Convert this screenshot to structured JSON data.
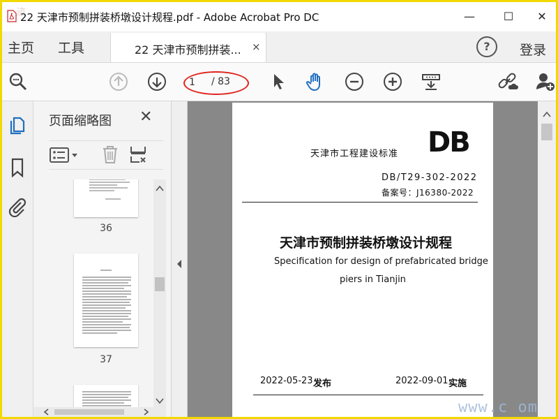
{
  "window": {
    "title": "22 天津市预制拼装桥墩设计规程.pdf - Adobe Acrobat Pro DC",
    "minimize": "—",
    "maximize": "☐",
    "close": "✕"
  },
  "menu": {
    "home": "主页",
    "tools": "工具",
    "help": "?",
    "login": "登录"
  },
  "tab": {
    "label": "22 天津市预制拼装...",
    "close": "×"
  },
  "toolbar": {
    "page_current": "1",
    "page_total": "/ 83",
    "icons": [
      "search-zoom-icon",
      "page-up-icon",
      "page-down-icon",
      "select-cursor-icon",
      "hand-tool-icon",
      "zoom-out-icon",
      "zoom-in-icon",
      "page-fit-icon",
      "share-link-icon",
      "add-user-icon"
    ],
    "accent": "#1f6fc1",
    "highlight": "#e0231d"
  },
  "sidebar": {
    "panel_title": "页面缩略图",
    "panel_close": "✕",
    "thumbnails": [
      {
        "label": "36"
      },
      {
        "label": "37"
      }
    ]
  },
  "document": {
    "issuer": "天津市工程建设标准",
    "logo": "DB",
    "code": "DB/T29-302-2022",
    "record": "备案号：J16380-2022",
    "title_cn": "天津市预制拼装桥墩设计规程",
    "title_en_1": "Specification for design of prefabricated bridge",
    "title_en_2": "piers in Tianjin",
    "publish_date": "2022-05-23",
    "publish_label": "发布",
    "effective_date": "2022-09-01",
    "effective_label": "实施"
  },
  "watermark": {
    "text": "www.c    om"
  }
}
